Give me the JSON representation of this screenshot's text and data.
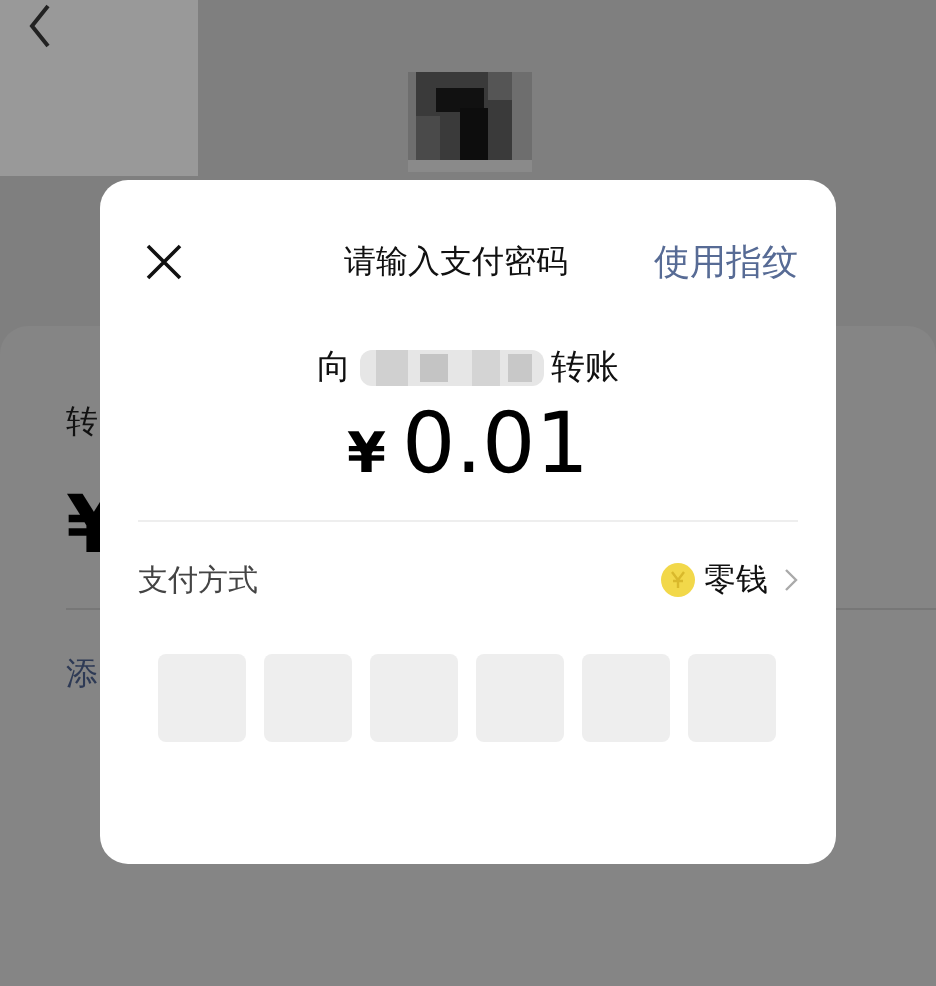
{
  "background": {
    "label": "转",
    "currency": "¥",
    "link": "添"
  },
  "dialog": {
    "title": "请输入支付密码",
    "fingerprint_link": "使用指纹",
    "payee_prefix": "向",
    "payee_suffix": "转账",
    "currency": "¥",
    "amount": "0.01",
    "payment_method": {
      "label": "支付方式",
      "value": "零钱"
    },
    "password_boxes": [
      {
        "filled": false
      },
      {
        "filled": false
      },
      {
        "filled": false
      },
      {
        "filled": false
      },
      {
        "filled": false
      },
      {
        "filled": false
      }
    ]
  }
}
